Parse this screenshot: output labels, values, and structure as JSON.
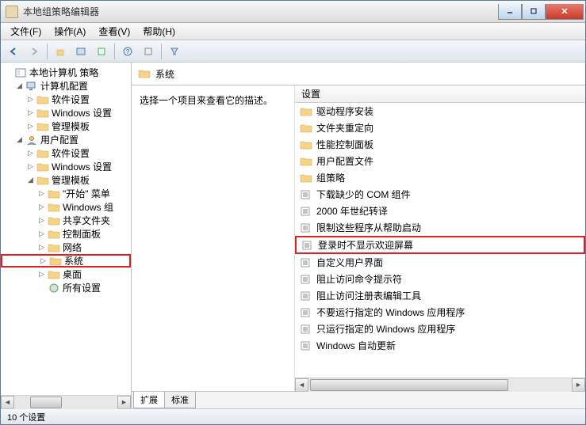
{
  "window": {
    "title": "本地组策略编辑器"
  },
  "menu": {
    "file": "文件(F)",
    "action": "操作(A)",
    "view": "查看(V)",
    "help": "帮助(H)"
  },
  "tree": {
    "root": "本地计算机 策略",
    "computer": "计算机配置",
    "computer_children": [
      "软件设置",
      "Windows 设置",
      "管理模板"
    ],
    "user": "用户配置",
    "user_children": [
      "软件设置",
      "Windows 设置"
    ],
    "admin_templates": "管理模板",
    "admin_children": [
      "\"开始\" 菜单",
      "Windows 组",
      "共享文件夹",
      "控制面板",
      "网络",
      "系统",
      "桌面",
      "所有设置"
    ]
  },
  "right": {
    "title": "系统",
    "desc": "选择一个项目来查看它的描述。",
    "list_header": "设置",
    "folders": [
      "驱动程序安装",
      "文件夹重定向",
      "性能控制面板",
      "用户配置文件",
      "组策略"
    ],
    "settings": [
      "下载缺少的 COM 组件",
      "2000 年世纪转译",
      "限制这些程序从帮助启动",
      "登录时不显示欢迎屏幕",
      "自定义用户界面",
      "阻止访问命令提示符",
      "阻止访问注册表编辑工具",
      "不要运行指定的 Windows 应用程序",
      "只运行指定的 Windows 应用程序",
      "Windows 自动更新"
    ],
    "highlighted_setting_index": 3,
    "tabs": {
      "extended": "扩展",
      "standard": "标准"
    }
  },
  "status": "10 个设置"
}
